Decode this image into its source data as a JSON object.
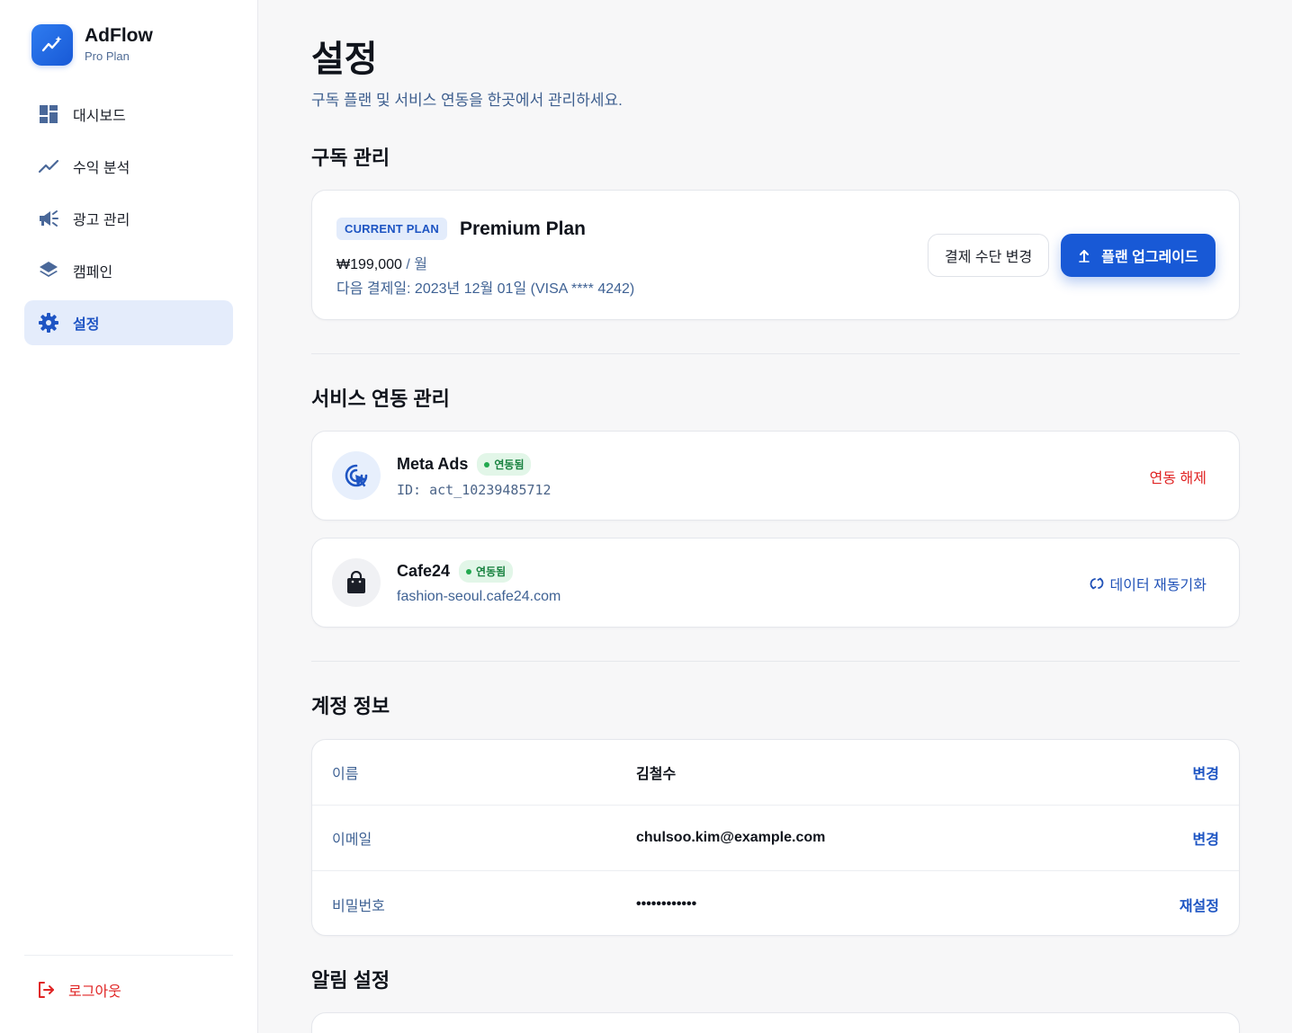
{
  "brand": {
    "name": "AdFlow",
    "plan": "Pro Plan"
  },
  "sidebar": {
    "items": [
      {
        "label": "대시보드",
        "icon": "dashboard-icon"
      },
      {
        "label": "수익 분석",
        "icon": "trending-up-icon"
      },
      {
        "label": "광고 관리",
        "icon": "megaphone-icon"
      },
      {
        "label": "캠페인",
        "icon": "layers-icon"
      },
      {
        "label": "설정",
        "icon": "gear-icon",
        "active": true
      }
    ],
    "logout": "로그아웃"
  },
  "page": {
    "title": "설정",
    "subtitle": "구독 플랜 및 서비스 연동을 한곳에서 관리하세요."
  },
  "subscription": {
    "section_title": "구독 관리",
    "badge": "CURRENT PLAN",
    "plan_name": "Premium Plan",
    "price": "₩199,000",
    "period": " / 월",
    "next_billing": "다음 결제일: 2023년 12월 01일 (VISA **** 4242)",
    "change_payment_label": "결제 수단 변경",
    "upgrade_label": "플랜 업그레이드"
  },
  "integrations": {
    "section_title": "서비스 연동 관리",
    "items": [
      {
        "name": "Meta Ads",
        "status": "연동됨",
        "detail": "ID: act_10239485712",
        "action": "연동 해제"
      },
      {
        "name": "Cafe24",
        "status": "연동됨",
        "detail": "fashion-seoul.cafe24.com",
        "action": "데이터 재동기화"
      }
    ]
  },
  "account": {
    "section_title": "계정 정보",
    "rows": [
      {
        "label": "이름",
        "value": "김철수",
        "action": "변경"
      },
      {
        "label": "이메일",
        "value": "chulsoo.kim@example.com",
        "action": "변경"
      },
      {
        "label": "비밀번호",
        "value": "••••••••••••",
        "action": "재설정"
      }
    ]
  },
  "notifications": {
    "section_title": "알림 설정"
  },
  "colors": {
    "accent": "#1859d6",
    "danger": "#e02424",
    "success": "#22a94f",
    "active_bg": "#e4ecfb"
  }
}
